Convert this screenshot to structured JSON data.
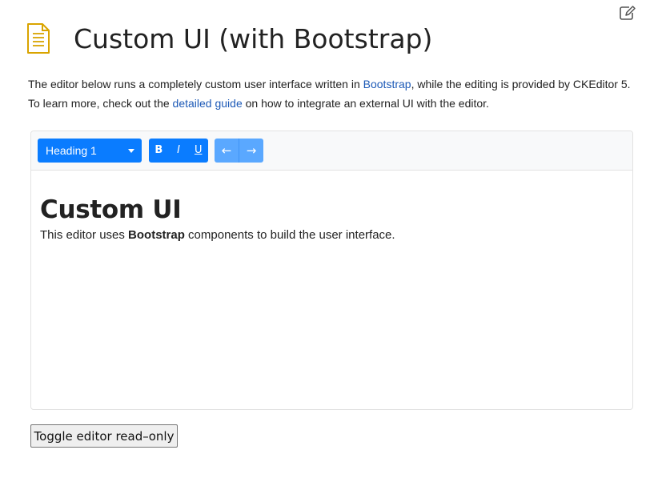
{
  "header": {
    "title": "Custom UI (with Bootstrap)",
    "icon": "document-icon",
    "edit_icon": "edit-icon"
  },
  "intro": {
    "line1_before": "The editor below runs a completely custom user interface written in ",
    "line1_link": "Bootstrap",
    "line1_after": ", while the editing is provided by CKEditor 5.",
    "line2_before": "To learn more, check out the ",
    "line2_link": "detailed guide",
    "line2_after": " on how to integrate an external UI with the editor."
  },
  "toolbar": {
    "heading_value": "Heading 1",
    "bold_label": "B",
    "italic_label": "I",
    "underline_label": "U",
    "undo_label": "←",
    "redo_label": "→"
  },
  "content": {
    "heading": "Custom UI",
    "para_before": "This editor uses ",
    "para_bold": "Bootstrap",
    "para_after": " components to build the user interface."
  },
  "actions": {
    "toggle_label": "Toggle editor read–only"
  },
  "colors": {
    "accent": "#0a7cff",
    "accent_light": "#5aa8ff",
    "link": "#1d5ab7",
    "doc_icon": "#d9a400"
  }
}
